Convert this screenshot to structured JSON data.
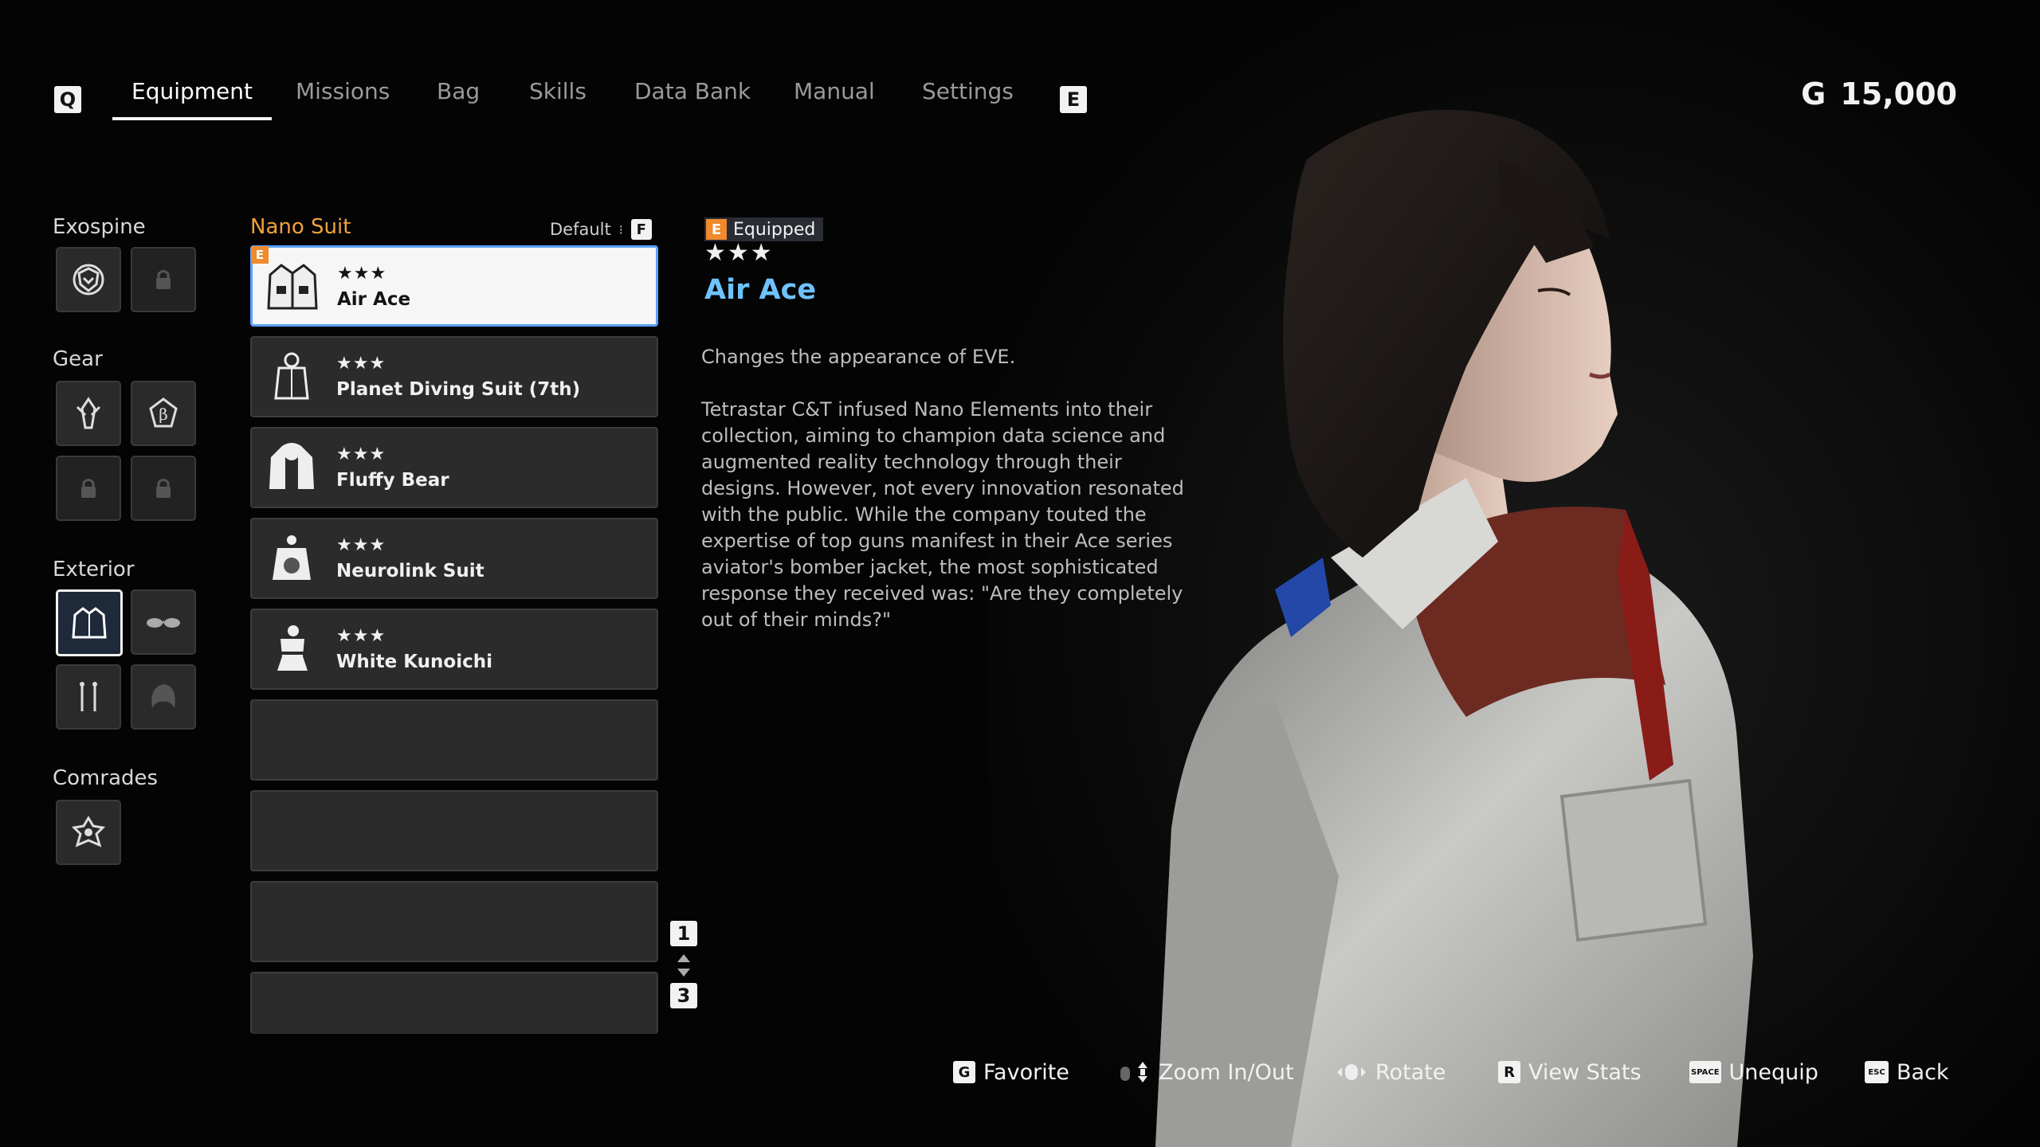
{
  "nav": {
    "left_key": "Q",
    "right_key": "E",
    "tabs": [
      {
        "label": "Equipment",
        "active": true
      },
      {
        "label": "Missions"
      },
      {
        "label": "Bag"
      },
      {
        "label": "Skills"
      },
      {
        "label": "Data Bank"
      },
      {
        "label": "Manual"
      },
      {
        "label": "Settings"
      }
    ],
    "currency_symbol": "G",
    "currency_amount": "15,000"
  },
  "categories": {
    "exospine": "Exospine",
    "gear": "Gear",
    "exterior": "Exterior",
    "comrades": "Comrades"
  },
  "list": {
    "title": "Nano Suit",
    "sort_label": "Default",
    "sort_key": "F",
    "equipped_flag": "E",
    "items": [
      {
        "stars": "★★★",
        "name": "Air Ace",
        "selected": true,
        "equipped": true
      },
      {
        "stars": "★★★",
        "name": "Planet Diving Suit (7th)"
      },
      {
        "stars": "★★★",
        "name": "Fluffy Bear"
      },
      {
        "stars": "★★★",
        "name": "Neurolink Suit"
      },
      {
        "stars": "★★★",
        "name": "White Kunoichi"
      }
    ],
    "page_up_key": "1",
    "page_down_key": "3"
  },
  "detail": {
    "equipped_key": "E",
    "equipped_label": "Equipped",
    "stars": "★★★",
    "name": "Air Ace",
    "description_1": "Changes the appearance of EVE.",
    "description_2": "Tetrastar C&T infused Nano Elements into their collection, aiming to champion data science and augmented reality technology through their designs. However, not every innovation resonated with the public. While the company touted the expertise of top guns manifest in their Ace series aviator's bomber jacket, the most sophisticated response they received was: \"Are they completely out of their minds?\""
  },
  "hints": [
    {
      "key": "G",
      "label": "Favorite"
    },
    {
      "key": "",
      "label": "Zoom In/Out"
    },
    {
      "key": "",
      "label": "Rotate"
    },
    {
      "key": "R",
      "label": "View Stats"
    },
    {
      "key": "SPACE",
      "label": "Unequip"
    },
    {
      "key": "ESC",
      "label": "Back"
    }
  ],
  "colors": {
    "accent_orange": "#f08a2c",
    "accent_blue": "#6ec3ff",
    "selected_border": "#5aa2ff"
  }
}
